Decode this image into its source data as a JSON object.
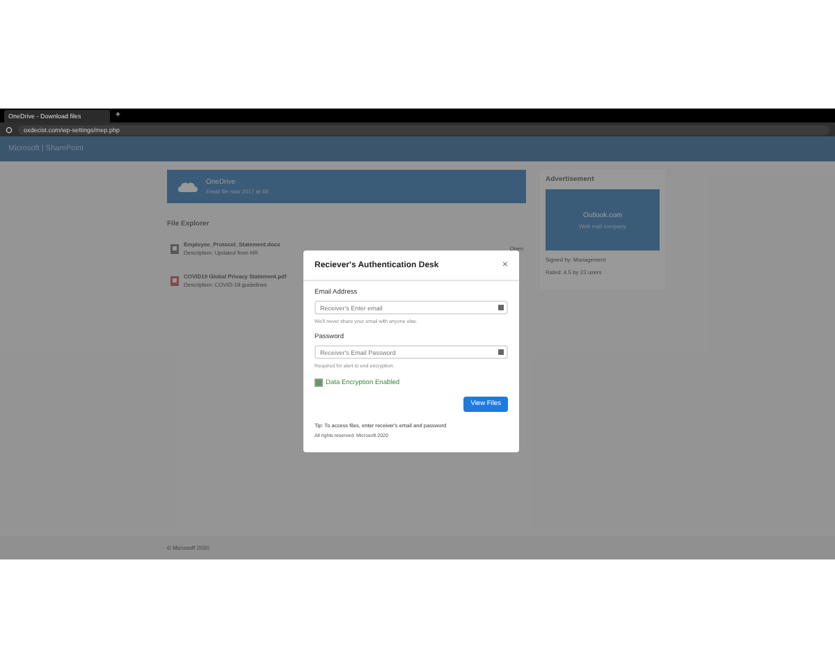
{
  "browser": {
    "tabs": [
      {
        "label": "OneDrive - Download files",
        "selected": true
      }
    ],
    "new_tab": "+",
    "url": "oxdecist.com/wp-settings/mep.php"
  },
  "nav": {
    "brand": "Microsoft | SharePoint"
  },
  "banner": {
    "title": "OneDrive",
    "subtitle": "Email file now 2017 at 48"
  },
  "files": {
    "heading": "File Explorer",
    "items": [
      {
        "kind": "doc",
        "name": "Employee_Protocol_Statement.docx",
        "description": "Description: Updated from HR",
        "action": "Open"
      },
      {
        "kind": "pdf",
        "name": "COVID19 Global Privacy Statement.pdf",
        "description": "Description: COVID-19 guidelines"
      }
    ]
  },
  "advert": {
    "heading": "Advertisement",
    "product": "Outlook.com",
    "tagline": "Web mail company",
    "lines": [
      "Signed by: Management",
      "Rated: 4.5 by 23 users"
    ]
  },
  "modal": {
    "title": "Reciever's Authentication Desk",
    "close": "×",
    "fields": [
      {
        "label": "Email Address",
        "placeholder": "Receiver's Enter email",
        "help": "We'll never share your email with anyone else."
      },
      {
        "label": "Password",
        "placeholder": "Receiver's Email Password",
        "help": "Required for alert to end encryption."
      }
    ],
    "checkbox": {
      "label": "Data Encryption Enabled",
      "checked": true
    },
    "button": "View Files",
    "tip": "Tip: To access files, enter receiver's email and password",
    "rights": "All rights reserved. Microsoft 2020"
  },
  "footer": "© Microsoft 2020"
}
